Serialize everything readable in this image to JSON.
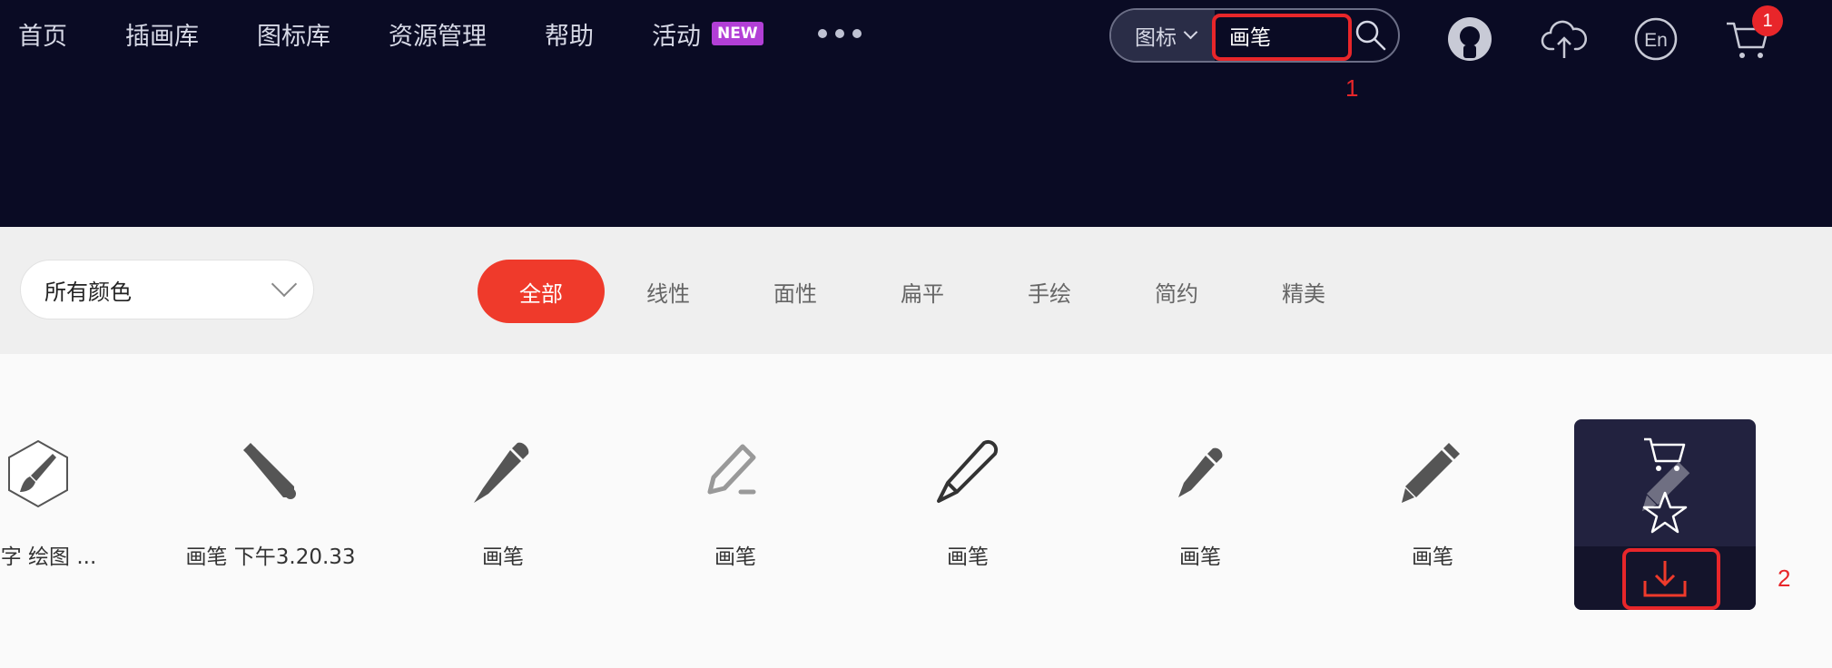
{
  "nav": {
    "items": [
      "首页",
      "插画库",
      "图标库",
      "资源管理",
      "帮助"
    ],
    "activity_label": "活动",
    "new_badge": "NEW",
    "more_icon": "more-dots-icon"
  },
  "search": {
    "type_label": "图标",
    "value": "画笔",
    "button_icon": "search-icon"
  },
  "annotations": {
    "first": "1",
    "second": "2"
  },
  "header_icons": {
    "user": "avatar-icon",
    "upload": "cloud-upload-icon",
    "language": "En",
    "cart": "cart-icon",
    "cart_count": "1"
  },
  "filters": {
    "color_select": "所有颜色",
    "tabs": [
      "全部",
      "线性",
      "面性",
      "扁平",
      "手绘",
      "简约",
      "精美"
    ],
    "active_tab": "全部"
  },
  "icons": [
    {
      "label": "写字 绘图 ...",
      "icon": "paintbrush-hexagon-icon"
    },
    {
      "label": "画笔 下午3.20.33",
      "icon": "marker-pen-icon"
    },
    {
      "label": "画笔",
      "icon": "pen-filled-icon"
    },
    {
      "label": "画笔",
      "icon": "pencil-outline-gray-icon"
    },
    {
      "label": "画笔",
      "icon": "pen-outline-icon"
    },
    {
      "label": "画笔",
      "icon": "pen-small-icon"
    },
    {
      "label": "画笔",
      "icon": "pencil-filled-icon"
    }
  ],
  "hover_card": {
    "cart_icon": "add-to-cart-icon",
    "star_icon": "favorite-star-icon",
    "download_icon": "download-icon"
  },
  "colors": {
    "header_bg": "#0a0b24",
    "accent": "#ef3a2b",
    "highlight": "#e8262a",
    "new_badge": "#b23fd6"
  }
}
